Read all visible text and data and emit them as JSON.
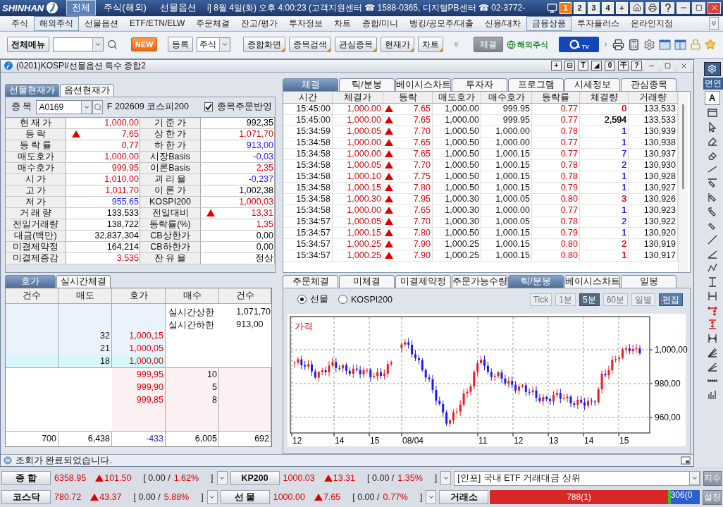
{
  "title_bar": {
    "logo": "SHINHAN",
    "tabs": [
      {
        "label": "전체",
        "selected": true
      },
      {
        "label": "주식(해외)",
        "selected": false
      },
      {
        "label": "선물옵션",
        "selected": false
      }
    ],
    "clock": "i] 8월 4일(화) 오후 4:00:23 (고객지원센터 ☎ 1588-0365, 디지털PB센터 ☎ 02-3772-",
    "screens": [
      {
        "label": "1",
        "selected": true
      },
      {
        "label": "2",
        "selected": false
      },
      {
        "label": "3",
        "selected": false
      },
      {
        "label": "4",
        "selected": false
      },
      {
        "label": "+",
        "selected": false
      }
    ]
  },
  "menu": [
    {
      "label": "주식",
      "selected": false
    },
    {
      "label": "해외주식",
      "selected": true
    },
    {
      "label": "선물옵션",
      "selected": false
    },
    {
      "label": "ETF/ETN/ELW",
      "selected": false
    },
    {
      "label": "주문체결",
      "selected": false
    },
    {
      "label": "잔고/평가",
      "selected": false
    },
    {
      "label": "투자정보",
      "selected": false
    },
    {
      "label": "차트",
      "selected": false
    },
    {
      "label": "종합/미니",
      "selected": false
    },
    {
      "label": "뱅킹/공모주/대출",
      "selected": false
    },
    {
      "label": "신용/대차",
      "selected": false
    },
    {
      "label": "금융상품",
      "selected": true
    },
    {
      "label": "투자플러스",
      "selected": false
    },
    {
      "label": "온라인지점",
      "selected": false
    }
  ],
  "toolbar": {
    "menu_button": "전체메뉴",
    "new_badge": "NEW",
    "register": "등록",
    "category": "주식",
    "shortcuts": [
      "종합화면",
      "종목검색",
      "관심종목",
      "현재가",
      "차트"
    ],
    "fill_button": "체결",
    "overseas_logo": "해외주식",
    "tv_logo": "TV"
  },
  "window": {
    "title": "(0201)KOSPI/선물옵션 특수 종합2",
    "tools": [
      "+",
      "⊟",
      "T",
      "◢",
      "0",
      "干",
      "?"
    ]
  },
  "quote_panel": {
    "tabs": [
      {
        "label": "선물현재가",
        "selected": true
      },
      {
        "label": "옵션현재가",
        "selected": false
      }
    ],
    "symbol_label": "종 목",
    "symbol": "A0169",
    "symbol_name": "F 202609 코스피200",
    "order_link": {
      "label": "종목주문반영",
      "checked": true
    },
    "rows": [
      {
        "cells": [
          {
            "label": "현 재 가",
            "value": "1,000,00",
            "color": "#e00000",
            "rising": false
          },
          {
            "label": "기 준 가",
            "value": "992,35",
            "color": "#000000",
            "rising": false
          }
        ]
      },
      {
        "cells": [
          {
            "label": "등 락",
            "value": "7,65",
            "color": "#e00000",
            "rising": true
          },
          {
            "label": "상 한 가",
            "value": "1,071,70",
            "color": "#e00000",
            "rising": false
          }
        ]
      },
      {
        "cells": [
          {
            "label": "등 락 률",
            "value": "0,77",
            "color": "#e00000",
            "rising": false
          },
          {
            "label": "하 한 가",
            "value": "913,00",
            "color": "#1a1aff",
            "rising": false
          }
        ]
      },
      {
        "cells": [
          {
            "label": "매도호가",
            "value": "1,000,00",
            "color": "#e00000",
            "rising": false
          },
          {
            "label": "시장Basis",
            "value": "-0,03",
            "color": "#1a1aff",
            "rising": false
          }
        ]
      },
      {
        "cells": [
          {
            "label": "매수호가",
            "value": "999,95",
            "color": "#e00000",
            "rising": false
          },
          {
            "label": "이론Basis",
            "value": "2,35",
            "color": "#e00000",
            "rising": false
          }
        ]
      },
      {
        "cells": [
          {
            "label": "시 가",
            "value": "1,010,00",
            "color": "#e00000",
            "rising": false
          },
          {
            "label": "괴 리 율",
            "value": "-0,237",
            "color": "#1a1aff",
            "rising": false
          }
        ]
      },
      {
        "cells": [
          {
            "label": "고 가",
            "value": "1,011,70",
            "color": "#e00000",
            "rising": false
          },
          {
            "label": "이 론 가",
            "value": "1,002,38",
            "color": "#000000",
            "rising": false
          }
        ]
      },
      {
        "cells": [
          {
            "label": "저 가",
            "value": "955,65",
            "color": "#1a1aff",
            "rising": false
          },
          {
            "label": "KOSPI200",
            "value": "1,000,03",
            "color": "#e00000",
            "rising": false
          }
        ]
      },
      {
        "cells": [
          {
            "label": "거 래 량",
            "value": "133,533",
            "color": "#000000",
            "rising": false
          },
          {
            "label": "전일대비",
            "value": "13,31",
            "color": "#e00000",
            "rising": true
          }
        ]
      },
      {
        "cells": [
          {
            "label": "전일거래량",
            "value": "138,722",
            "color": "#000000",
            "rising": false
          },
          {
            "label": "등락률(%)",
            "value": "1,35",
            "color": "#e00000",
            "rising": false
          }
        ]
      },
      {
        "cells": [
          {
            "label": "대금(백만)",
            "value": "32,837,304",
            "color": "#000000",
            "rising": false
          },
          {
            "label": "CB상한가",
            "value": "0,00",
            "color": "#000000",
            "rising": false
          }
        ]
      },
      {
        "cells": [
          {
            "label": "미결제약정",
            "value": "164,214",
            "color": "#000000",
            "rising": false
          },
          {
            "label": "CB하한가",
            "value": "0,00",
            "color": "#000000",
            "rising": false
          }
        ]
      },
      {
        "cells": [
          {
            "label": "미결제증감",
            "value": "3,535",
            "color": "#e00000",
            "rising": false
          },
          {
            "label": "잔 유 율",
            "value": "정상",
            "color": "#000000",
            "rising": false
          }
        ]
      }
    ]
  },
  "trades_panel": {
    "tabs": [
      {
        "label": "체결",
        "selected": true
      },
      {
        "label": "틱/분봉",
        "selected": false
      },
      {
        "label": "베이시스차트",
        "selected": false
      },
      {
        "label": "투자자",
        "selected": false
      },
      {
        "label": "프로그램",
        "selected": false
      },
      {
        "label": "시세정보",
        "selected": false
      },
      {
        "label": "관심종목",
        "selected": false
      }
    ],
    "columns": [
      "시간",
      "체결가",
      "등락",
      "매도호가",
      "매수호가",
      "등락률",
      "체결량",
      "거래량"
    ],
    "rows": [
      {
        "time": "15:45:00",
        "price": "1,000.00",
        "rising": true,
        "change": "7.65",
        "ask": "1,000.00",
        "bid": "999.95",
        "rate": "0.77",
        "volume": "0",
        "color": "#e00000",
        "total": "133,533"
      },
      {
        "time": "15:45:00",
        "price": "1,000.00",
        "rising": true,
        "change": "7.65",
        "ask": "1,000.00",
        "bid": "999.95",
        "rate": "0.77",
        "volume": "2,594",
        "color": "#000000",
        "total": "133,533"
      },
      {
        "time": "15:34:59",
        "price": "1,000.05",
        "rising": true,
        "change": "7.70",
        "ask": "1,000.50",
        "bid": "1,000.00",
        "rate": "0.78",
        "volume": "1",
        "color": "#1a1aff",
        "total": "130,939"
      },
      {
        "time": "15:34:58",
        "price": "1,000.00",
        "rising": true,
        "change": "7.65",
        "ask": "1,000.50",
        "bid": "1,000.00",
        "rate": "0.77",
        "volume": "1",
        "color": "#1a1aff",
        "total": "130,938"
      },
      {
        "time": "15:34:58",
        "price": "1,000.00",
        "rising": true,
        "change": "7.65",
        "ask": "1,000.50",
        "bid": "1,000.15",
        "rate": "0.77",
        "volume": "7",
        "color": "#1a1aff",
        "total": "130,937"
      },
      {
        "time": "15:34:58",
        "price": "1,000.05",
        "rising": true,
        "change": "7.70",
        "ask": "1,000.50",
        "bid": "1,000.15",
        "rate": "0.78",
        "volume": "2",
        "color": "#1a1aff",
        "total": "130,930"
      },
      {
        "time": "15:34:58",
        "price": "1,000.10",
        "rising": true,
        "change": "7.75",
        "ask": "1,000.50",
        "bid": "1,000.15",
        "rate": "0.78",
        "volume": "1",
        "color": "#1a1aff",
        "total": "130,928"
      },
      {
        "time": "15:34:58",
        "price": "1,000.15",
        "rising": true,
        "change": "7.80",
        "ask": "1,000.50",
        "bid": "1,000.15",
        "rate": "0.79",
        "volume": "1",
        "color": "#1a1aff",
        "total": "130,927"
      },
      {
        "time": "15:34:58",
        "price": "1,000.30",
        "rising": true,
        "change": "7.95",
        "ask": "1,000.30",
        "bid": "1,000.05",
        "rate": "0.80",
        "volume": "3",
        "color": "#e00000",
        "total": "130,926"
      },
      {
        "time": "15:34:58",
        "price": "1,000.00",
        "rising": true,
        "change": "7.65",
        "ask": "1,000.30",
        "bid": "1,000.00",
        "rate": "0.77",
        "volume": "1",
        "color": "#1a1aff",
        "total": "130,923"
      },
      {
        "time": "15:34:57",
        "price": "1,000.05",
        "rising": true,
        "change": "7.70",
        "ask": "1,000.30",
        "bid": "1,000.05",
        "rate": "0.78",
        "volume": "2",
        "color": "#1a1aff",
        "total": "130,922"
      },
      {
        "time": "15:34:57",
        "price": "1,000.15",
        "rising": true,
        "change": "7.80",
        "ask": "1,000.50",
        "bid": "1,000.15",
        "rate": "0.79",
        "volume": "1",
        "color": "#1a1aff",
        "total": "130,920"
      },
      {
        "time": "15:34:57",
        "price": "1,000.25",
        "rising": true,
        "change": "7.90",
        "ask": "1,000.25",
        "bid": "1,000.15",
        "rate": "0.80",
        "volume": "2",
        "color": "#e00000",
        "total": "130,919"
      },
      {
        "time": "15:34:57",
        "price": "1,000.25",
        "rising": true,
        "change": "7.90",
        "ask": "1,000.25",
        "bid": "1,000.15",
        "rate": "0.80",
        "volume": "1",
        "color": "#e00000",
        "total": "130,917"
      }
    ]
  },
  "order_book": {
    "tabs": [
      {
        "label": "호가",
        "selected": true
      },
      {
        "label": "실시간체결",
        "selected": false
      }
    ],
    "columns": [
      "건수",
      "매도",
      "호가",
      "매수",
      "건수"
    ],
    "asks": [
      {
        "quantity": "32",
        "price": "1,000,15",
        "selected": false
      },
      {
        "quantity": "21",
        "price": "1,000,05",
        "selected": false
      },
      {
        "quantity": "18",
        "price": "1,000,00",
        "selected": true
      }
    ],
    "limits": [
      {
        "label": "실시간상한",
        "value": "1,071,70"
      },
      {
        "label": "실시간하한",
        "value": "913,00"
      }
    ],
    "bids": [
      {
        "price": "999,95",
        "quantity": "10"
      },
      {
        "price": "999,90",
        "quantity": "5"
      },
      {
        "price": "999,85",
        "quantity": "8"
      }
    ],
    "totals": [
      {
        "value": "700",
        "color": "#000000"
      },
      {
        "value": "6,438",
        "color": "#000000"
      },
      {
        "value": "-433",
        "color": "#1a1aff"
      },
      {
        "value": "6,005",
        "color": "#000000"
      },
      {
        "value": "692",
        "color": "#000000"
      }
    ]
  },
  "chart_panel": {
    "tabs": [
      {
        "label": "주문체결",
        "selected": false
      },
      {
        "label": "미체결",
        "selected": false
      },
      {
        "label": "미결제약정",
        "selected": false
      },
      {
        "label": "주문가능수량",
        "selected": false
      },
      {
        "label": "틱/분봉",
        "selected": true
      },
      {
        "label": "베이시스차트",
        "selected": false
      },
      {
        "label": "일봉",
        "selected": false
      }
    ],
    "sources": [
      {
        "label": "선물",
        "selected": true
      },
      {
        "label": "KOSPI200",
        "selected": false
      }
    ],
    "periods": [
      {
        "label": "Tick",
        "selected": false,
        "disabled": true
      },
      {
        "label": "1분",
        "selected": false,
        "disabled": true
      },
      {
        "label": "5분",
        "selected": true,
        "disabled": false
      },
      {
        "label": "60분",
        "selected": false,
        "disabled": true
      },
      {
        "label": "일별",
        "selected": false,
        "disabled": true
      }
    ],
    "edit_button": "편집",
    "chart": {
      "title": "가격",
      "y_labels": [
        "1,000,00",
        "980,00",
        "960,00"
      ],
      "x_labels": [
        "12",
        "14",
        "15",
        "08/04",
        "11",
        "12",
        "13",
        "14",
        "15"
      ]
    }
  },
  "side_strip": {
    "partial_label": "면연",
    "font_button": "A"
  },
  "status": "조회가 완료되었습니다.",
  "ticker_rows": [
    {
      "quotes": [
        {
          "label": "종 합",
          "value": "6358.95",
          "rising": true,
          "change": "101.50",
          "open": "[ 0.00 /",
          "rate": "1.62%",
          "close": "]"
        },
        {
          "label": "KP200",
          "value": "1000.03",
          "rising": true,
          "change": "13.31",
          "open": "[ 0.00 /",
          "rate": "1.35%",
          "close": "]"
        }
      ],
      "extra": {
        "kind": "info",
        "text": "[인포] 국내 ETF 거래대금 상위"
      },
      "button": "지수"
    },
    {
      "quotes": [
        {
          "label": "코스닥",
          "value": "780.72",
          "rising": true,
          "change": "43.37",
          "open": "[ 0.00 /",
          "rate": "5.88%",
          "close": "]"
        },
        {
          "label": "선 물",
          "value": "1000.00",
          "rising": true,
          "change": "7.65",
          "open": "[ 0.00 /",
          "rate": "0.77%",
          "close": "]"
        }
      ],
      "extra": {
        "kind": "breadth",
        "label": "거래소",
        "level": 0.86,
        "up": "788(1)",
        "down": "306(0"
      },
      "button": "설정"
    }
  ]
}
